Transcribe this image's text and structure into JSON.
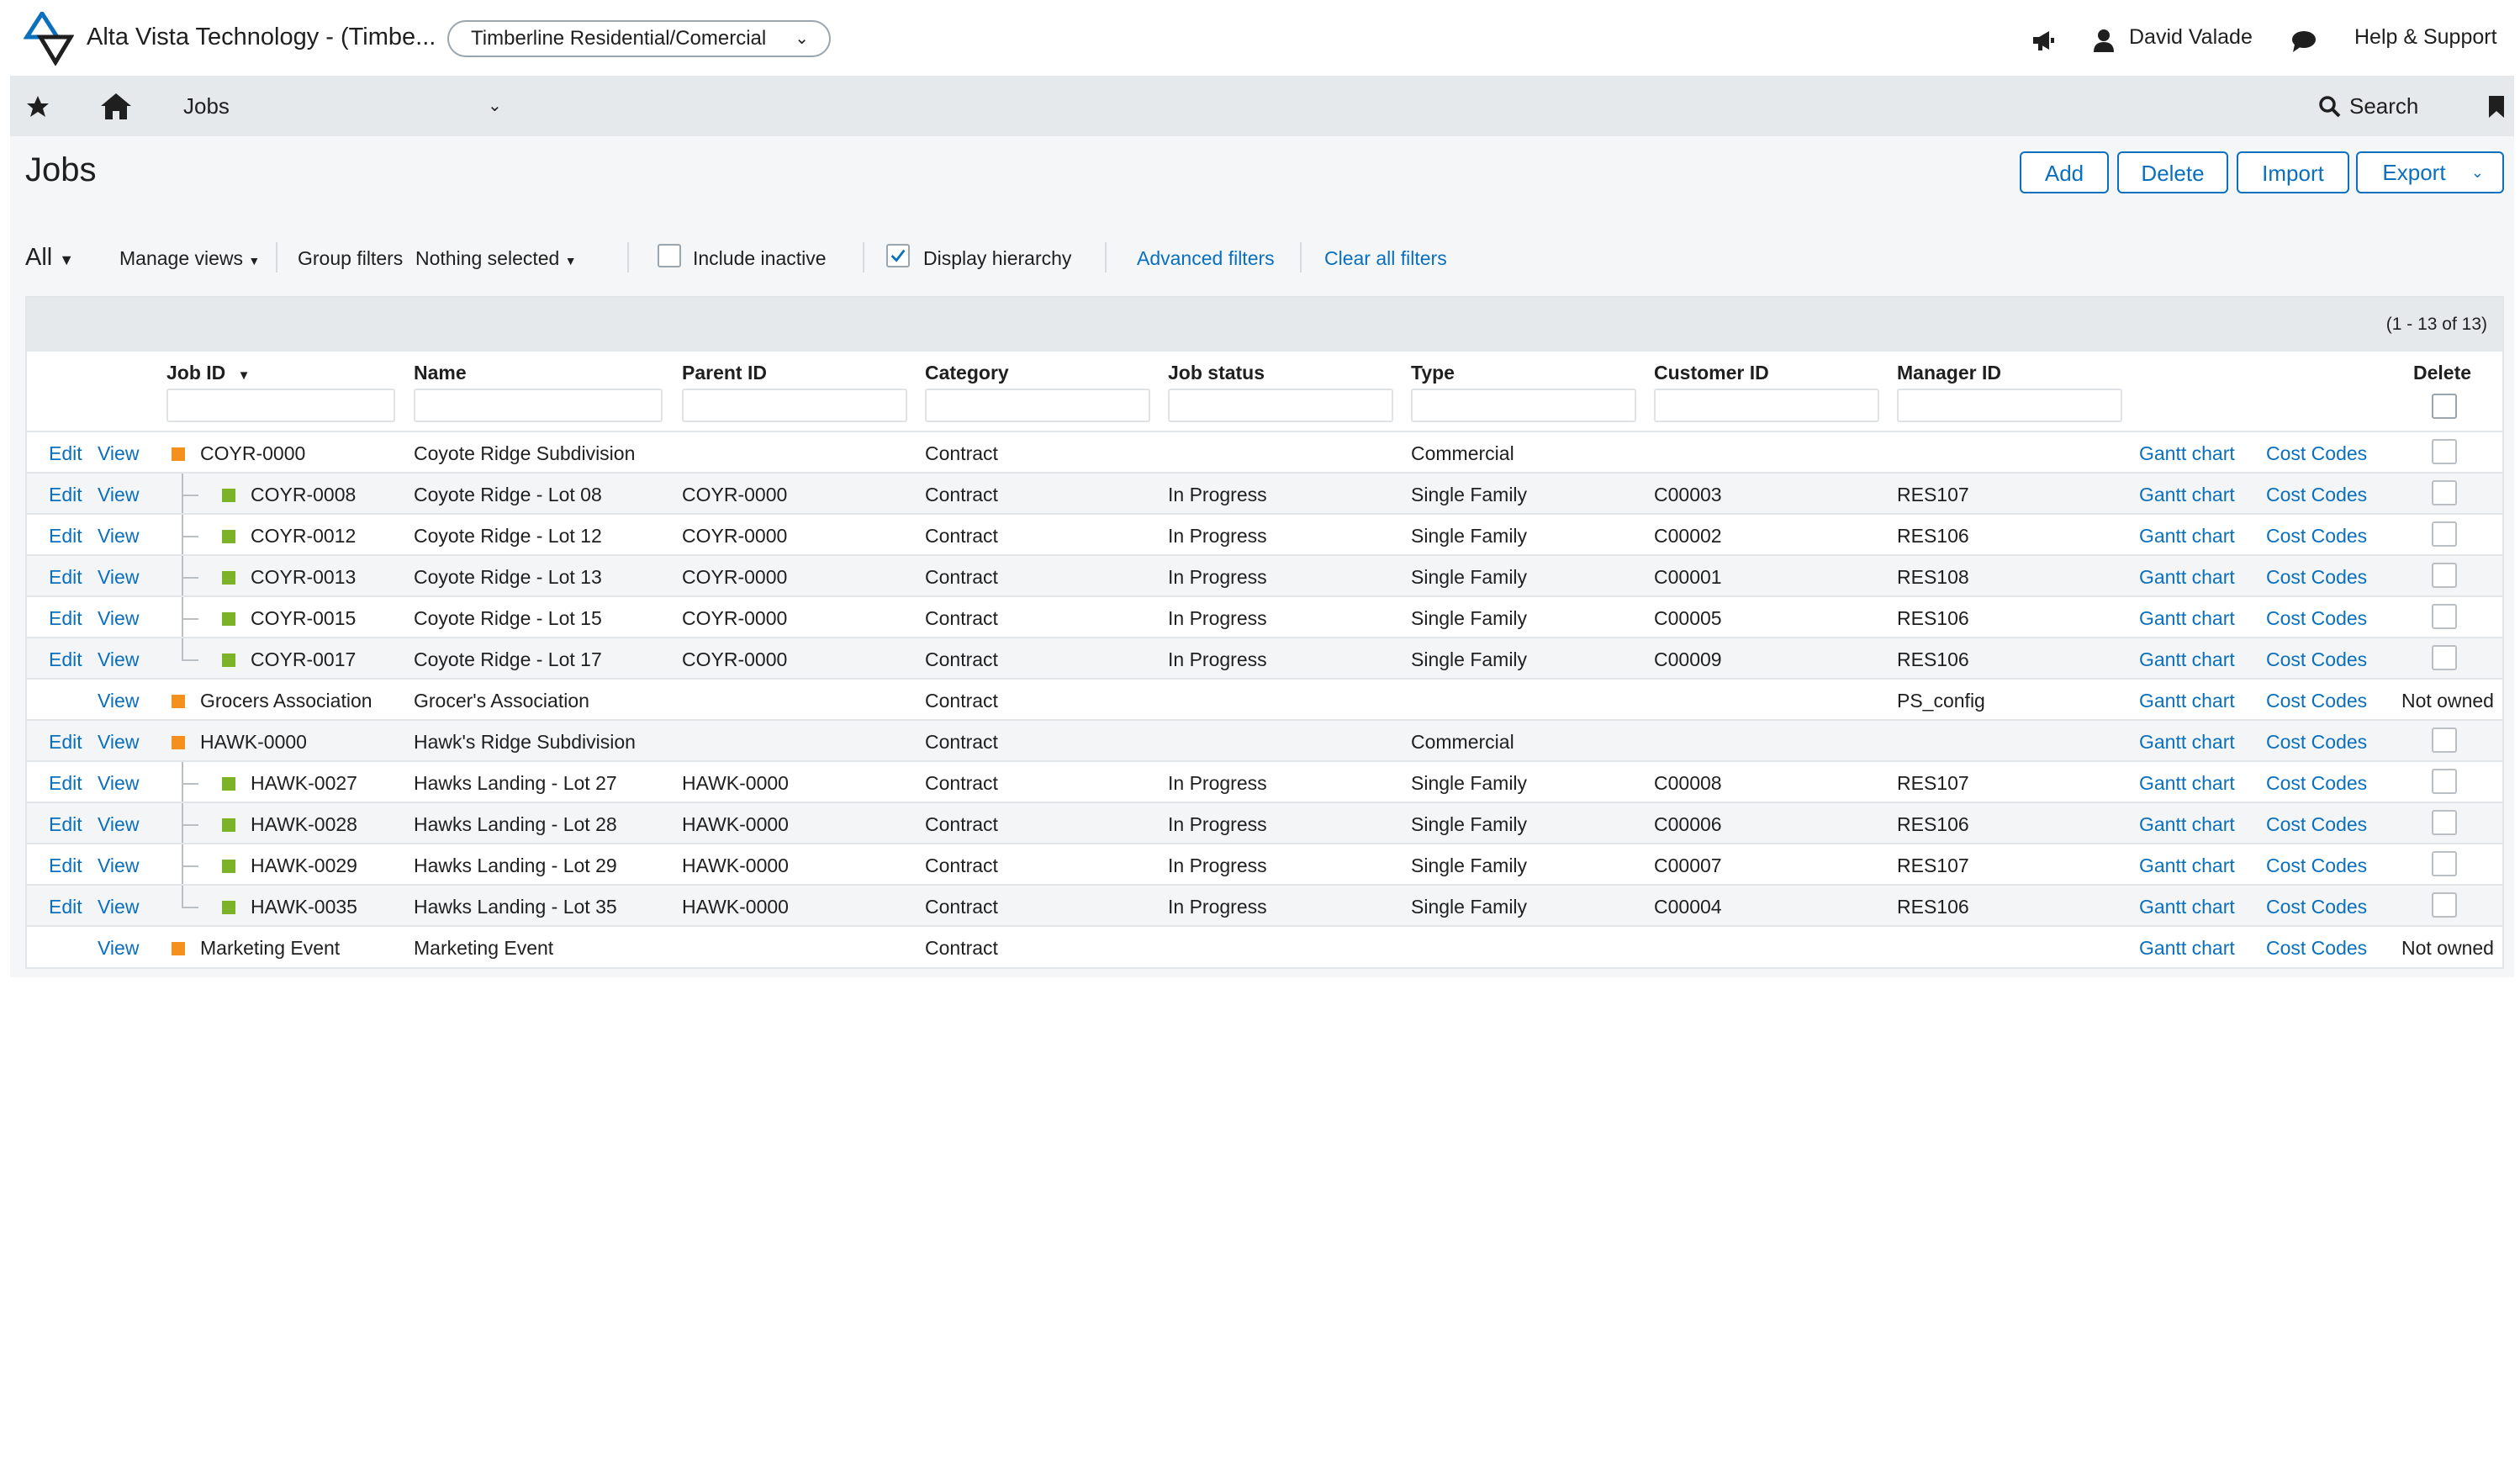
{
  "header": {
    "company": "Alta Vista Technology - (Timbe...",
    "entity": "Timberline Residential/Comercial",
    "user": "David Valade",
    "help": "Help & Support"
  },
  "nav": {
    "module": "Jobs",
    "search": "Search"
  },
  "page": {
    "title": "Jobs",
    "buttons": {
      "add": "Add",
      "delete": "Delete",
      "import": "Import",
      "export": "Export"
    }
  },
  "filters": {
    "view": "All",
    "manage_views": "Manage views",
    "group_filters_label": "Group filters",
    "group_filters_value": "Nothing selected",
    "include_inactive": "Include inactive",
    "display_hierarchy": "Display hierarchy",
    "advanced_filters": "Advanced filters",
    "clear_all": "Clear all filters"
  },
  "grid": {
    "count": "(1 - 13 of 13)",
    "columns": {
      "job_id": "Job ID",
      "name": "Name",
      "parent_id": "Parent ID",
      "category": "Category",
      "job_status": "Job status",
      "type": "Type",
      "customer_id": "Customer ID",
      "manager_id": "Manager ID",
      "delete": "Delete"
    },
    "actions": {
      "edit": "Edit",
      "view": "View",
      "gantt": "Gantt chart",
      "cost_codes": "Cost Codes",
      "not_owned": "Not owned"
    },
    "rows": [
      {
        "job_id": "COYR-0000",
        "name": "Coyote Ridge Subdivision",
        "parent_id": "",
        "category": "Contract",
        "status": "",
        "type": "Commercial",
        "customer": "",
        "manager": ""
      },
      {
        "job_id": "COYR-0008",
        "name": "Coyote Ridge - Lot 08",
        "parent_id": "COYR-0000",
        "category": "Contract",
        "status": "In Progress",
        "type": "Single Family",
        "customer": "C00003",
        "manager": "RES107"
      },
      {
        "job_id": "COYR-0012",
        "name": "Coyote Ridge - Lot 12",
        "parent_id": "COYR-0000",
        "category": "Contract",
        "status": "In Progress",
        "type": "Single Family",
        "customer": "C00002",
        "manager": "RES106"
      },
      {
        "job_id": "COYR-0013",
        "name": "Coyote Ridge - Lot 13",
        "parent_id": "COYR-0000",
        "category": "Contract",
        "status": "In Progress",
        "type": "Single Family",
        "customer": "C00001",
        "manager": "RES108"
      },
      {
        "job_id": "COYR-0015",
        "name": "Coyote Ridge - Lot 15",
        "parent_id": "COYR-0000",
        "category": "Contract",
        "status": "In Progress",
        "type": "Single Family",
        "customer": "C00005",
        "manager": "RES106"
      },
      {
        "job_id": "COYR-0017",
        "name": "Coyote Ridge - Lot 17",
        "parent_id": "COYR-0000",
        "category": "Contract",
        "status": "In Progress",
        "type": "Single Family",
        "customer": "C00009",
        "manager": "RES106"
      },
      {
        "job_id": "Grocers Association",
        "name": "Grocer's Association",
        "parent_id": "",
        "category": "Contract",
        "status": "",
        "type": "",
        "customer": "",
        "manager": "PS_config"
      },
      {
        "job_id": "HAWK-0000",
        "name": "Hawk's Ridge Subdivision",
        "parent_id": "",
        "category": "Contract",
        "status": "",
        "type": "Commercial",
        "customer": "",
        "manager": ""
      },
      {
        "job_id": "HAWK-0027",
        "name": "Hawks Landing - Lot 27",
        "parent_id": "HAWK-0000",
        "category": "Contract",
        "status": "In Progress",
        "type": "Single Family",
        "customer": "C00008",
        "manager": "RES107"
      },
      {
        "job_id": "HAWK-0028",
        "name": "Hawks Landing - Lot 28",
        "parent_id": "HAWK-0000",
        "category": "Contract",
        "status": "In Progress",
        "type": "Single Family",
        "customer": "C00006",
        "manager": "RES106"
      },
      {
        "job_id": "HAWK-0029",
        "name": "Hawks Landing - Lot 29",
        "parent_id": "HAWK-0000",
        "category": "Contract",
        "status": "In Progress",
        "type": "Single Family",
        "customer": "C00007",
        "manager": "RES107"
      },
      {
        "job_id": "HAWK-0035",
        "name": "Hawks Landing - Lot 35",
        "parent_id": "HAWK-0000",
        "category": "Contract",
        "status": "In Progress",
        "type": "Single Family",
        "customer": "C00004",
        "manager": "RES106"
      },
      {
        "job_id": "Marketing Event",
        "name": "Marketing Event",
        "parent_id": "",
        "category": "Contract",
        "status": "",
        "type": "",
        "customer": "",
        "manager": ""
      }
    ]
  },
  "colors": {
    "accent": "#0a6fbd",
    "parent_marker": "#f3901e",
    "child_marker": "#7cb228"
  }
}
